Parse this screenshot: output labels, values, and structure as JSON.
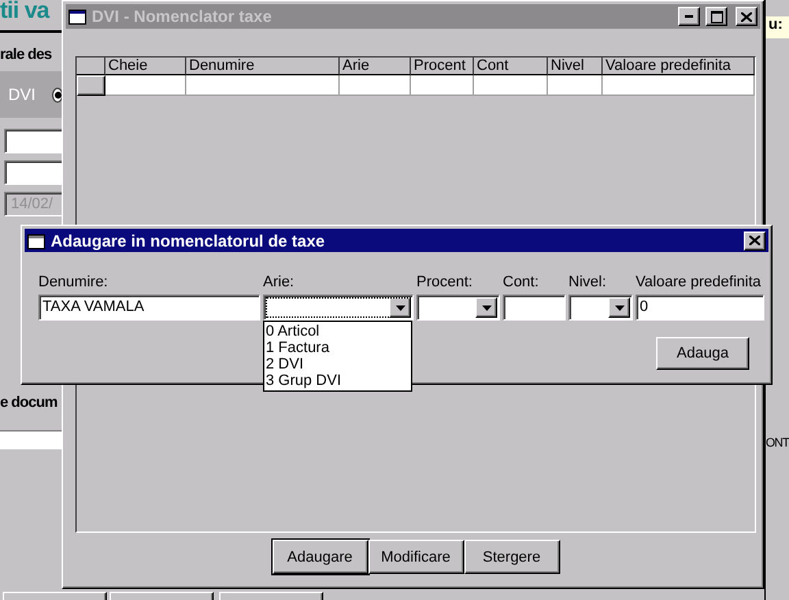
{
  "background_app": {
    "title": "tii va",
    "section_label": "rale des",
    "panel_label": "DVI",
    "radio_selected": true,
    "date_field": "14/02/",
    "section_label_2": "e docum",
    "right_label": "u:",
    "right_column_header": "ONT"
  },
  "main_window": {
    "title": "DVI - Nomenclator taxe",
    "active": false,
    "table": {
      "columns": [
        "Cheie",
        "Denumire",
        "Arie",
        "Procent",
        "Cont",
        "Nivel",
        "Valoare predefinita"
      ]
    },
    "buttons": [
      "Adaugare",
      "Modificare",
      "Stergere"
    ]
  },
  "dialog": {
    "title": "Adaugare in nomenclatorul de taxe",
    "active": true,
    "fields": [
      {
        "label": "Denumire:",
        "kind": "text",
        "value": "TAXA VAMALA"
      },
      {
        "label": "Arie:",
        "kind": "combo",
        "expanded": true,
        "options": [
          "0 Articol",
          "1 Factura",
          "2 DVI",
          "3 Grup DVI"
        ]
      },
      {
        "label": "Procent:",
        "kind": "combo"
      },
      {
        "label": "Cont:",
        "kind": "text"
      },
      {
        "label": "Nivel:",
        "kind": "combo"
      },
      {
        "label": "Valoare predefinita",
        "kind": "text",
        "value": "0"
      }
    ],
    "button": "Adauga"
  }
}
